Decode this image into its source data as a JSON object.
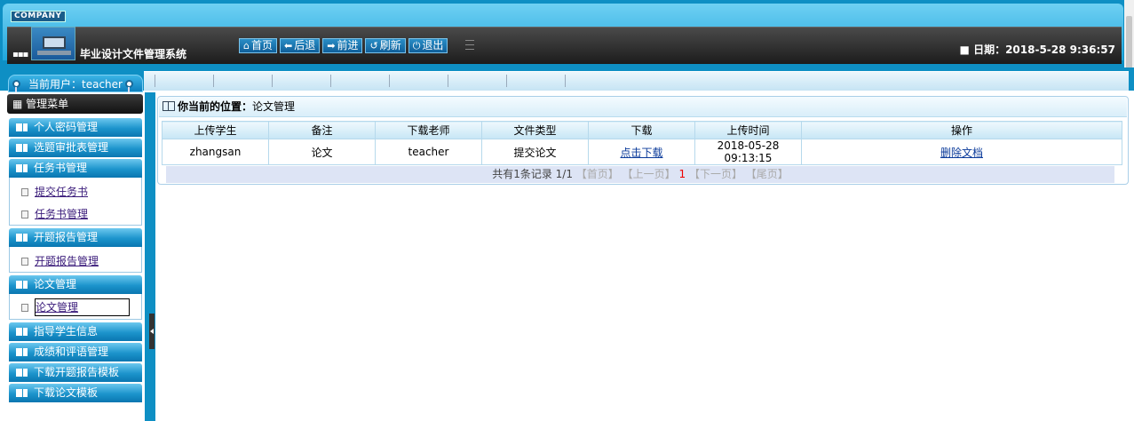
{
  "header": {
    "company": "COMPANY",
    "system_title": "毕业设计文件管理系统",
    "nav": [
      {
        "label": "首页",
        "icon": "home-icon",
        "glyph": "⌂"
      },
      {
        "label": "后退",
        "icon": "back-arrow-icon",
        "glyph": "⬅"
      },
      {
        "label": "前进",
        "icon": "forward-arrow-icon",
        "glyph": "➡"
      },
      {
        "label": "刷新",
        "icon": "refresh-icon",
        "glyph": "↺"
      },
      {
        "label": "退出",
        "icon": "power-icon",
        "glyph": "⏻"
      }
    ],
    "date_label": "■ 日期：2018-5-28 9:36:57"
  },
  "user": {
    "label": "当前用户：teacher"
  },
  "sidebar": {
    "menu_title": "管理菜单",
    "sections": [
      {
        "label": "个人密码管理"
      },
      {
        "label": "选题审批表管理"
      },
      {
        "label": "任务书管理",
        "items": [
          "提交任务书",
          "任务书管理"
        ]
      },
      {
        "label": "开题报告管理",
        "items": [
          "开题报告管理"
        ]
      },
      {
        "label": "论文管理",
        "items": [
          "论文管理"
        ]
      },
      {
        "label": "指导学生信息"
      },
      {
        "label": "成绩和评语管理"
      },
      {
        "label": "下载开题报告模板"
      },
      {
        "label": "下载论文模板"
      }
    ]
  },
  "main": {
    "location_label": "你当前的位置：",
    "location_value": "论文管理",
    "table": {
      "headers": [
        "上传学生",
        "备注",
        "下载老师",
        "文件类型",
        "下载",
        "上传时间",
        "操作"
      ],
      "rows": [
        [
          "zhangsan",
          "论文",
          "teacher",
          "提交论文",
          "点击下载",
          "2018-05-28 09:13:15",
          "删除文档"
        ]
      ]
    },
    "pager": {
      "summary": "共有1条记录  1/1",
      "first": "【首页】",
      "prev": "【上一页】",
      "current": "1",
      "next": "【下一页】",
      "last": "【尾页】"
    }
  },
  "colors": {
    "accent": "#0e8fc4",
    "dark_bar": "#1c1c1c",
    "link": "#0a3a9a"
  }
}
